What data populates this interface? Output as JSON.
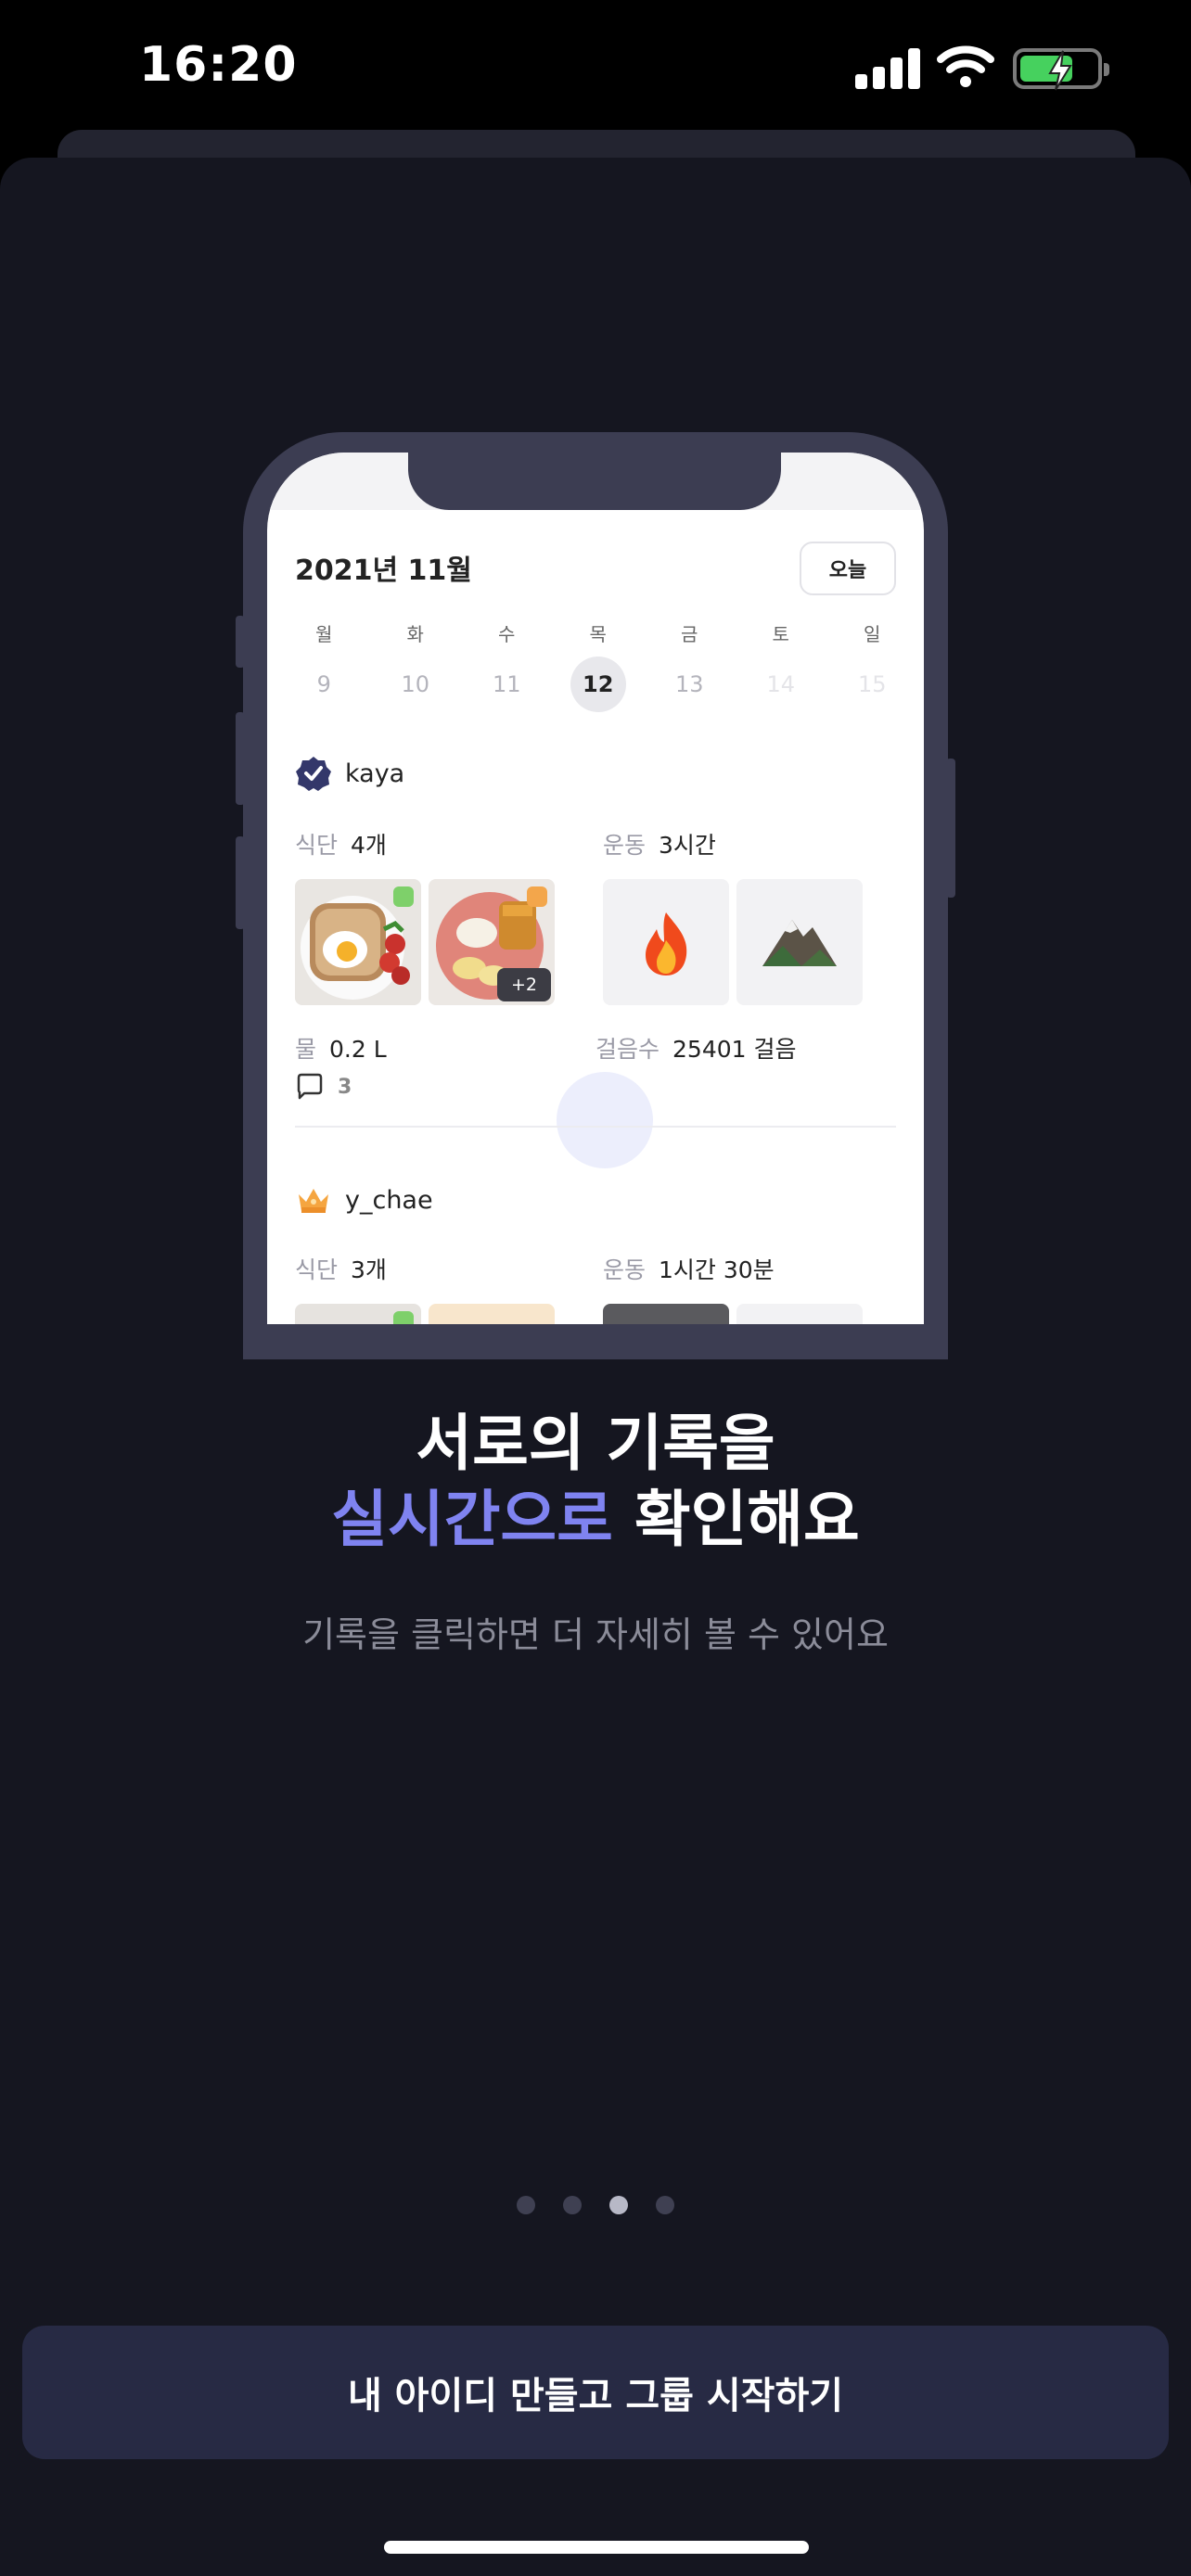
{
  "status_bar": {
    "time": "16:20"
  },
  "mockup": {
    "month": "2021년 11월",
    "today_label": "오늘",
    "week": [
      {
        "name": "월",
        "num": "9",
        "state": "past"
      },
      {
        "name": "화",
        "num": "10",
        "state": "past"
      },
      {
        "name": "수",
        "num": "11",
        "state": "past"
      },
      {
        "name": "목",
        "num": "12",
        "state": "selected"
      },
      {
        "name": "금",
        "num": "13",
        "state": "past"
      },
      {
        "name": "토",
        "num": "14",
        "state": "future"
      },
      {
        "name": "일",
        "num": "15",
        "state": "future"
      }
    ],
    "users": [
      {
        "name": "kaya",
        "meal_label": "식단",
        "meal_value": "4개",
        "exercise_label": "운동",
        "exercise_value": "3시간",
        "water_label": "물",
        "water_value": "0.2 L",
        "steps_label": "걸음수",
        "steps_value": "25401 걸음",
        "extra_photos": "+2",
        "comments": "3",
        "exercise_icons": [
          "🔥",
          "⛰"
        ]
      },
      {
        "name": "y_chae",
        "meal_label": "식단",
        "meal_value": "3개",
        "exercise_label": "운동",
        "exercise_value": "1시간 30분"
      }
    ]
  },
  "headline": {
    "line1": "서로의 기록을",
    "line2_accent": "실시간으로",
    "line2_rest": " 확인해요"
  },
  "subhead": "기록을 클릭하면 더 자세히 볼 수 있어요",
  "pager": {
    "count": 4,
    "active": 3
  },
  "cta_label": "내 아이디 만들고 그룹 시작하기",
  "colors": {
    "background": "#151620",
    "accent": "#7f83f0",
    "cta": "#272a44"
  }
}
